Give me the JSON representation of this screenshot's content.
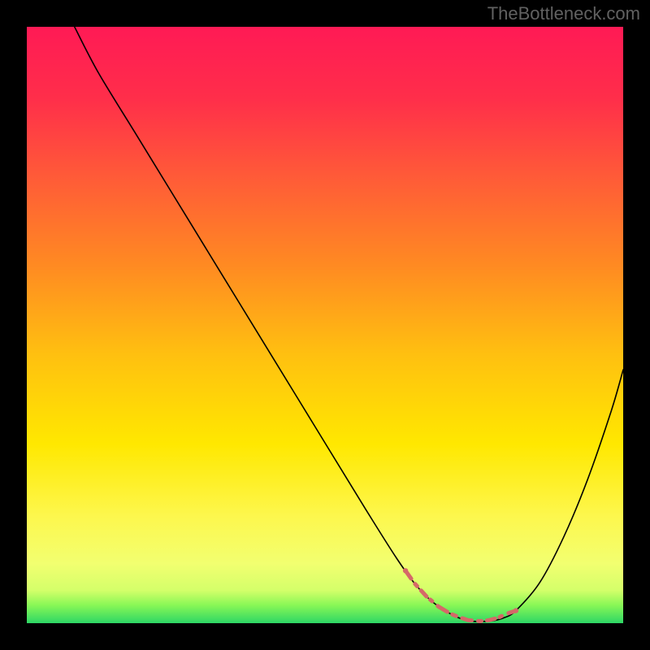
{
  "watermark": "TheBottleneck.com",
  "gradient": {
    "stops": [
      {
        "offset": 0.0,
        "color": "#ff1a55"
      },
      {
        "offset": 0.12,
        "color": "#ff2e4a"
      },
      {
        "offset": 0.25,
        "color": "#ff5a38"
      },
      {
        "offset": 0.4,
        "color": "#ff8a22"
      },
      {
        "offset": 0.55,
        "color": "#ffc010"
      },
      {
        "offset": 0.7,
        "color": "#ffe800"
      },
      {
        "offset": 0.82,
        "color": "#fdf74d"
      },
      {
        "offset": 0.9,
        "color": "#f2ff70"
      },
      {
        "offset": 0.945,
        "color": "#d4ff6a"
      },
      {
        "offset": 0.97,
        "color": "#88f756"
      },
      {
        "offset": 1.0,
        "color": "#2dd665"
      }
    ]
  },
  "chart_data": {
    "type": "line",
    "title": "TheBottleneck.com",
    "xlabel": "",
    "ylabel": "",
    "xlim": [
      0,
      100
    ],
    "ylim": [
      0,
      100
    ],
    "series": [
      {
        "name": "bottleneck-curve",
        "color": "#000000",
        "width": 1.6,
        "x": [
          8,
          12,
          18,
          24,
          30,
          36,
          42,
          48,
          54,
          58,
          62,
          65,
          68,
          71,
          73,
          75,
          78,
          80,
          82,
          86,
          90,
          94,
          98,
          100
        ],
        "values": [
          100,
          92.3,
          82.5,
          72.7,
          62.9,
          53.1,
          43.3,
          33.5,
          23.7,
          17.2,
          10.9,
          6.7,
          3.6,
          1.6,
          0.7,
          0.3,
          0.4,
          0.9,
          2.1,
          6.8,
          14.4,
          24.0,
          35.6,
          42.5
        ]
      },
      {
        "name": "optimal-zone",
        "color": "#d56868",
        "width": 5,
        "style": "dashed-dotty",
        "x": [
          63.5,
          65,
          67,
          69,
          71,
          72.5,
          74,
          76,
          77.5,
          79,
          80.5,
          82
        ],
        "values": [
          8.8,
          6.7,
          4.5,
          2.8,
          1.6,
          1.0,
          0.5,
          0.35,
          0.5,
          0.9,
          1.6,
          2.1
        ]
      }
    ]
  }
}
